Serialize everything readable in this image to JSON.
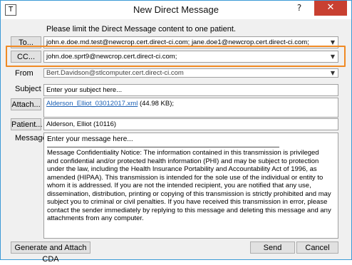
{
  "window": {
    "title": "New Direct Message",
    "app_icon": "T",
    "help_label": "?",
    "close_label": "✕"
  },
  "notice": "Please limit the Direct Message content to one patient.",
  "to": {
    "button_label": "To...",
    "value": "john.e.doe.md.test@newcrop.cert.direct-ci.com; jane.doe1@newcrop.cert.direct-ci.com;"
  },
  "cc": {
    "button_label": "CC...",
    "value": "john.doe.sprt9@newcrop.cert.direct-ci.com;"
  },
  "from": {
    "label": "From",
    "value": "Bert.Davidson@stlcomputer.cert.direct-ci.com"
  },
  "subject": {
    "label": "Subject",
    "placeholder": "Enter your subject here..."
  },
  "attach": {
    "button_label": "Attach...",
    "file_name": "Alderson_Elliot_03012017.xml",
    "file_size": "(44.98 KB);"
  },
  "patient": {
    "button_label": "Patient...",
    "value": "Alderson, Elliot (10116)"
  },
  "message": {
    "label": "Message",
    "placeholder": "Enter your message here...",
    "disclaimer": "Message Confidentiality Notice: The information contained in this transmission is privileged and confidential and/or protected health information (PHI) and may be subject to protection under the law, including the Health Insurance Portability and Accountability Act of 1996, as amended (HIPAA). This transmission is intended for the sole use of the individual or entity to whom it is addressed. If you are not the intended recipient, you are notified that any use, dissemination, distribution, printing or copying of this transmission is strictly prohibited and may subject you to criminal or civil penalties. If you have received this transmission in error, please contact the sender immediately by replying to this message and deleting this message and any attachments from any computer."
  },
  "footer": {
    "generate_label": "Generate and Attach CDA",
    "send_label": "Send",
    "cancel_label": "Cancel"
  },
  "icons": {
    "dropdown": "chevron-down-icon"
  },
  "colors": {
    "highlight": "#f08a24",
    "close": "#c84031",
    "border": "#3c9ad6"
  }
}
